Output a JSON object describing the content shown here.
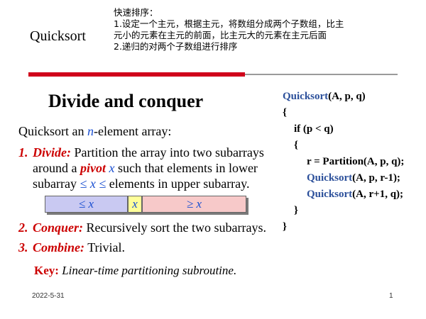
{
  "header": {
    "title": "Quicksort",
    "note_lines": [
      "快速排序：",
      "1.设定一个主元，根据主元，将数组分成两个子数组，比主",
      "元小的元素在主元的前面，比主元大的元素在主元后面",
      "2.递归的对两个子数组进行排序"
    ]
  },
  "slide": {
    "title": "Divide and conquer",
    "intro_pre": "Quicksort an ",
    "intro_var": "n",
    "intro_post": "-element array:",
    "items": [
      {
        "num": "1.",
        "keyword": "Divide:",
        "line1": " Partition the array into two subarrays",
        "line2_pre": "around a ",
        "line2_pivot": "pivot",
        "line2_sp": " ",
        "line2_x": "x",
        "line2_post": " such that elements in lower",
        "line3_pre": "subarray ",
        "line3_cmp": "≤ x ≤",
        "line3_post": " elements in upper subarray."
      },
      {
        "num": "2.",
        "keyword": "Conquer:",
        "text": " Recursively sort the two subarrays."
      },
      {
        "num": "3.",
        "keyword": "Combine:",
        "text": " Trivial."
      }
    ],
    "partition": {
      "left": "≤ x",
      "mid": "x",
      "right": "≥ x"
    },
    "key_label": "Key:",
    "key_text": " Linear-time partitioning subroutine."
  },
  "code": {
    "l1_fn": "Quicksort",
    "l1_args": "(A, p, q)",
    "l2": "{",
    "l3": "if (p < q)",
    "l4": "{",
    "l5": "r = Partition(A, p, q);",
    "l6_fn": "Quicksort",
    "l6_args": "(A, p, r-1);",
    "l7_fn": "Quicksort",
    "l7_args": "(A, r+1, q);",
    "l8": "}",
    "l9": "}"
  },
  "footer": {
    "date": "2022-5-31",
    "page": "1"
  },
  "colors": {
    "accent_red": "#cc0000",
    "rule_red": "#d0021b",
    "blue": "#1a4fd1",
    "code_blue": "#2b4f9a"
  }
}
